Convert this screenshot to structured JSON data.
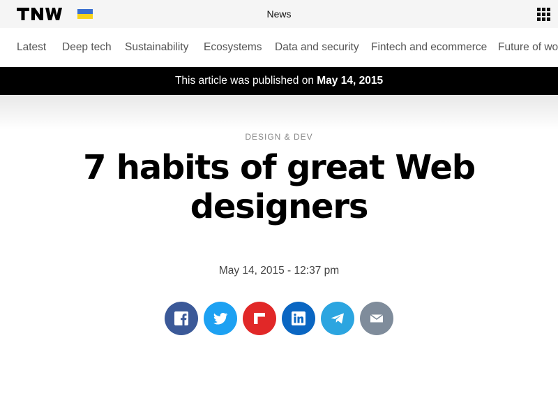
{
  "topbar": {
    "logo_text": "TNW",
    "flag_icon": "ukraine-flag-icon",
    "section_title": "News",
    "menu_icon": "grid-menu-icon"
  },
  "nav": {
    "items": [
      {
        "label": "Latest"
      },
      {
        "label": "Deep tech"
      },
      {
        "label": "Sustainability"
      },
      {
        "label": "Ecosystems"
      },
      {
        "label": "Data and security"
      },
      {
        "label": "Fintech and ecommerce"
      },
      {
        "label": "Future of work"
      }
    ]
  },
  "banner": {
    "prefix": "This article was published on ",
    "date": "May 14, 2015"
  },
  "article": {
    "category": "DESIGN & DEV",
    "title": "7 habits of great Web designers",
    "date": "May 14, 2015 - 12:37 pm"
  },
  "share": [
    {
      "icon": "facebook-icon",
      "color": "#3b5998"
    },
    {
      "icon": "twitter-icon",
      "color": "#1da1f2"
    },
    {
      "icon": "flipboard-icon",
      "color": "#e12828"
    },
    {
      "icon": "linkedin-icon",
      "color": "#0a66c2"
    },
    {
      "icon": "telegram-icon",
      "color": "#2ca5e0"
    },
    {
      "icon": "email-icon",
      "color": "#7f8c9b"
    }
  ]
}
